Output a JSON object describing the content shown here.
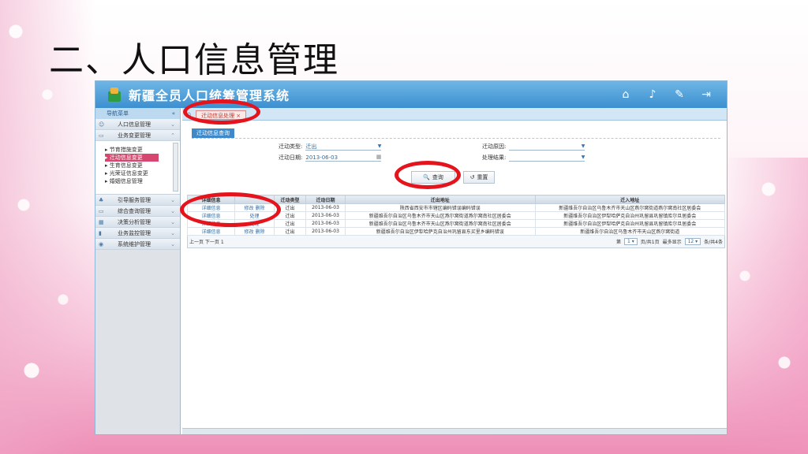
{
  "slide": {
    "title": "二、人口信息管理"
  },
  "app": {
    "title": "新疆全员人口统筹管理系统",
    "header_icons": [
      "home-icon",
      "bell-icon",
      "wrench-icon",
      "exit-icon"
    ]
  },
  "sidebar": {
    "header": "导航菜单",
    "items": [
      {
        "label": "人口信息管理",
        "icon": "person-icon"
      },
      {
        "label": "业务变更管理",
        "icon": "monitor-icon"
      }
    ],
    "sub_items": [
      {
        "label": "节育措施变更",
        "selected": false
      },
      {
        "label": "迁动信息变更",
        "selected": true
      },
      {
        "label": "生育信息变更",
        "selected": false
      },
      {
        "label": "光荣证信息变更",
        "selected": false
      },
      {
        "label": "婚姻信息管理",
        "selected": false
      }
    ],
    "bottom_items": [
      {
        "label": "引导服务管理",
        "icon": "guide-icon"
      },
      {
        "label": "综合查询管理",
        "icon": "query-icon"
      },
      {
        "label": "决策分析管理",
        "icon": "analysis-icon"
      },
      {
        "label": "业务监控管理",
        "icon": "chart-icon"
      },
      {
        "label": "系统维护管理",
        "icon": "settings-icon"
      }
    ]
  },
  "tabs": {
    "active": "迁动信息处理"
  },
  "search": {
    "section_label": "迁动信息查询",
    "type_label": "迁动类型:",
    "type_value": "迁出",
    "date_label": "迁动日期:",
    "date_value": "2013-06-03",
    "reason_label": "迁动原因:",
    "result_label": "处理结果:",
    "query_button": "查询",
    "reset_button": "重置"
  },
  "grid": {
    "columns": [
      "详细信息",
      "",
      "迁动类型",
      "迁动日期",
      "迁出地址",
      "迁入地址"
    ],
    "rows": [
      {
        "detail": "详细信息",
        "action": "修改 删除",
        "type": "迁出",
        "date": "2013-06-03",
        "from": "陕西省西安市市辖区编码错误编码错误",
        "to": "新疆维吾尔自治区乌鲁木齐市天山区燕尔窝街道燕尔窝南社区居委会"
      },
      {
        "detail": "详细信息",
        "action": "处理",
        "type": "迁出",
        "date": "2013-06-03",
        "from": "新疆维吾尔自治区乌鲁木齐市天山区燕尔窝街道燕尔窝南社区居委会",
        "to": "新疆维吾尔自治区伊犁哈萨克自治州巩留县巩留镇库尔旦居委会"
      },
      {
        "detail": "详细信息",
        "action": "处理",
        "type": "迁出",
        "date": "2013-06-03",
        "from": "新疆维吾尔自治区乌鲁木齐市天山区燕尔窝街道燕尔窝南社区居委会",
        "to": "新疆维吾尔自治区伊犁哈萨克自治州巩留县巩留镇库尔旦居委会"
      },
      {
        "detail": "详细信息",
        "action": "修改 删除",
        "type": "迁出",
        "date": "2013-06-03",
        "from": "新疆维吾尔自治区伊犁哈萨克自治州巩留县东买里乡编码错误",
        "to": "新疆维吾尔自治区乌鲁木齐市天山区燕尔窝街道"
      }
    ],
    "pager_left": "上一页 下一页",
    "pager_left_num": "1",
    "pager_page_label": "第",
    "pager_page_value": "1",
    "pager_page_total": "页/共1页",
    "pager_show_label": "最多显示",
    "pager_show_value": "12",
    "pager_total": "条/共4条"
  },
  "colors": {
    "header_blue": "#3c8fcf",
    "highlight_red": "#e5141c",
    "selected_pink": "#d6466e"
  }
}
